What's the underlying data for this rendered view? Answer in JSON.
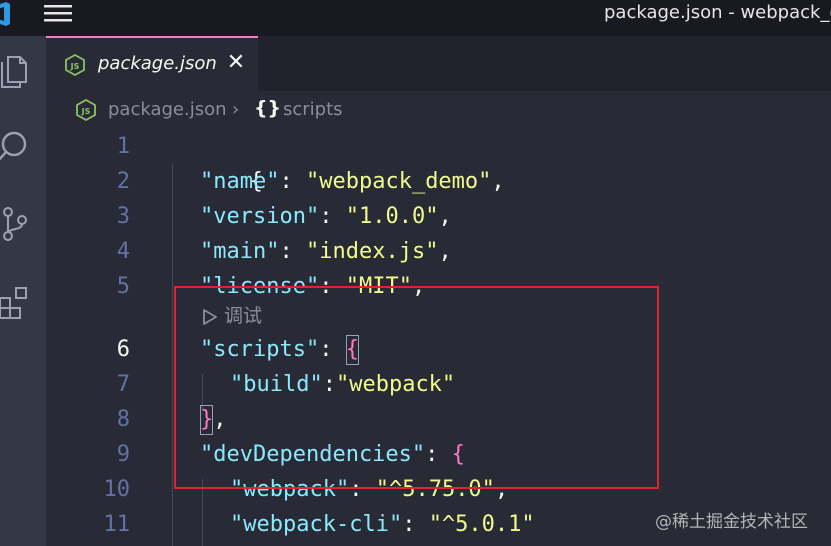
{
  "window": {
    "title": "package.json - webpack_de"
  },
  "activity_bar": {
    "items": [
      {
        "name": "explorer",
        "icon": "files-icon"
      },
      {
        "name": "search",
        "icon": "search-icon"
      },
      {
        "name": "source-control",
        "icon": "source-control-icon"
      },
      {
        "name": "extensions",
        "icon": "extensions-icon"
      }
    ]
  },
  "tabs": [
    {
      "label": "package.json",
      "icon": "js-file-icon",
      "active": true,
      "close": "✕"
    }
  ],
  "breadcrumb": {
    "file": "package.json",
    "separator": "›",
    "symbol_icon": "{}",
    "symbol": "scripts"
  },
  "editor": {
    "language": "json",
    "active_line": 6,
    "codelens": "调试",
    "lines": [
      {
        "num": "1",
        "text": "{"
      },
      {
        "num": "2",
        "text": "\"name\": \"webpack_demo\","
      },
      {
        "num": "3",
        "text": "\"version\": \"1.0.0\","
      },
      {
        "num": "4",
        "text": "\"main\": \"index.js\","
      },
      {
        "num": "5",
        "text": "\"license\": \"MIT\","
      },
      {
        "num": "6",
        "text": "\"scripts\": {"
      },
      {
        "num": "7",
        "text": "\"build\":\"webpack\""
      },
      {
        "num": "8",
        "text": "},"
      },
      {
        "num": "9",
        "text": "\"devDependencies\": {"
      },
      {
        "num": "10",
        "text": "\"webpack\": \"^5.75.0\","
      },
      {
        "num": "11",
        "text": "\"webpack-cli\": \"^5.0.1\""
      }
    ],
    "tokens": {
      "l1_brace": "{",
      "l2_key": "\"name\"",
      "l2_colon": ": ",
      "l2_val": "\"webpack_demo\"",
      "l2_comma": ",",
      "l3_key": "\"version\"",
      "l3_colon": ": ",
      "l3_val": "\"1.0.0\"",
      "l3_comma": ",",
      "l4_key": "\"main\"",
      "l4_colon": ": ",
      "l4_val": "\"index.js\"",
      "l4_comma": ",",
      "l5_key": "\"license\"",
      "l5_colon": ": ",
      "l5_val": "\"MIT\"",
      "l5_comma": ",",
      "l6_key": "\"scripts\"",
      "l6_colon": ": ",
      "l6_brace": "{",
      "l7_key": "\"build\"",
      "l7_colon": ":",
      "l7_val": "\"webpack\"",
      "l8_brace": "}",
      "l8_comma": ",",
      "l9_key": "\"devDependencies\"",
      "l9_colon": ": ",
      "l9_brace": "{",
      "l10_key": "\"webpack\"",
      "l10_colon": ": ",
      "l10_val": "\"^5.75.0\"",
      "l10_comma": ",",
      "l11_key": "\"webpack-cli\"",
      "l11_colon": ": ",
      "l11_val": "\"^5.0.1\""
    }
  },
  "colors": {
    "editor_bg": "#282a36",
    "key": "#8be9fd",
    "string": "#f1fa8c",
    "brace": "#ff79c6",
    "annotation_box": "#e0242c"
  },
  "watermark": "@稀土掘金技术社区"
}
